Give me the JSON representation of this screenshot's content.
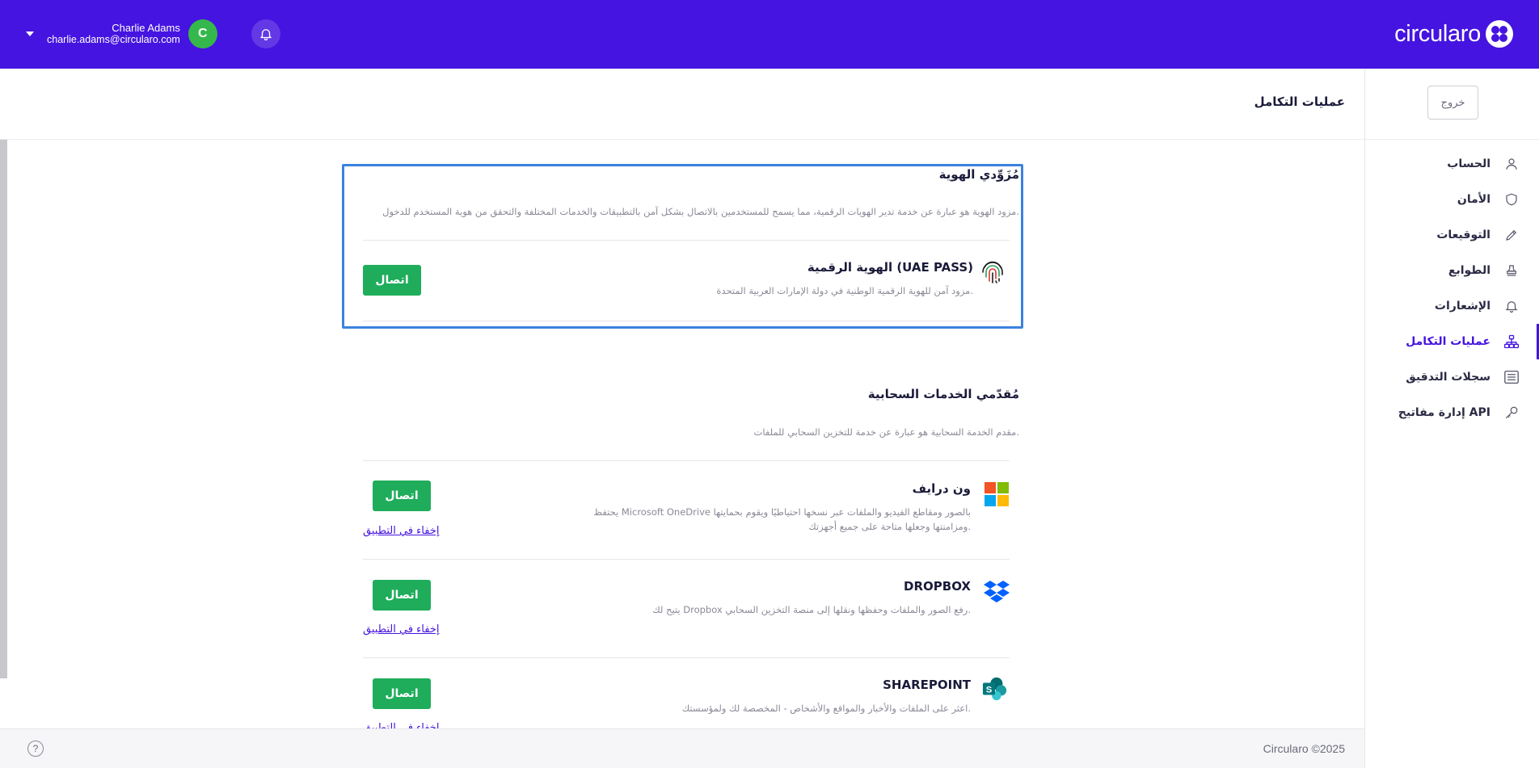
{
  "app": {
    "logo_text": "circularo"
  },
  "user": {
    "name": "Charlie Adams",
    "email": "charlie.adams@circularo.com",
    "initial": "C"
  },
  "header": {
    "page_title": "عمليات التكامل"
  },
  "sidebar": {
    "logout_label": "خروج",
    "items": [
      {
        "label": "الحساب",
        "icon": "user-icon"
      },
      {
        "label": "الأمان",
        "icon": "shield-icon"
      },
      {
        "label": "التوقيعات",
        "icon": "pencil-icon"
      },
      {
        "label": "الطوابع",
        "icon": "stamp-icon"
      },
      {
        "label": "الإشعارات",
        "icon": "bell-icon"
      },
      {
        "label": "عمليات التكامل",
        "icon": "integrations-icon",
        "active": true
      },
      {
        "label": "سجلات التدقيق",
        "icon": "list-icon"
      },
      {
        "label": "إدارة مفاتيح API",
        "icon": "key-icon"
      }
    ]
  },
  "identity": {
    "title": "مُزَوِّدي الهوية",
    "description": "مزود الهوية هو عبارة عن خدمة تدير الهويات الرقمية، مما يسمح للمستخدمين بالاتصال بشكل آمن بالتطبيقات والخدمات المختلفة والتحقق من هوية المستخدم للدخول.",
    "providers": [
      {
        "name": "الهوية الرقمية (UAE PASS)",
        "description": "مزود آمن للهوية الرقمية الوطنية في دولة الإمارات العربية المتحدة.",
        "connect_label": "اتصال",
        "icon": "fingerprint-icon"
      }
    ]
  },
  "cloud": {
    "title": "مُقدّمي الخدمات السحابية",
    "description": "مقدم الخدمة السحابية هو عبارة عن خدمة للتخزين السحابي للملفات.",
    "providers": [
      {
        "name": "ون درايف",
        "description_line1": "يحتفظ Microsoft OneDrive بالصور ومقاطع الفيديو والملفات عبر نسخها احتياطيًا ويقوم بحمايتها",
        "description_line2": "ومزامنتها وجعلها متاحة على جميع أجهزتك.",
        "connect_label": "اتصال",
        "hide_label": "إخفاء في التطبيق",
        "icon": "microsoft-icon"
      },
      {
        "name": "DROPBOX",
        "description_line1": "يتيح لك Dropbox رفع الصور والملفات وحفظها ونقلها إلى منصة التخزين السحابي.",
        "connect_label": "اتصال",
        "hide_label": "إخفاء في التطبيق",
        "icon": "dropbox-icon"
      },
      {
        "name": "SHAREPOINT",
        "description_line1": "اعثر على الملفات والأخبار والمواقع والأشخاص - المخصصة لك ولمؤسستك.",
        "connect_label": "اتصال",
        "hide_label": "إخفاء في التطبيق",
        "icon": "sharepoint-icon"
      }
    ]
  },
  "footer": {
    "copyright": "Circularo ©2025",
    "help_icon": "help-icon"
  },
  "colors": {
    "brand": "#4514e0",
    "success": "#1fad5b",
    "focus": "#3b82e0"
  }
}
